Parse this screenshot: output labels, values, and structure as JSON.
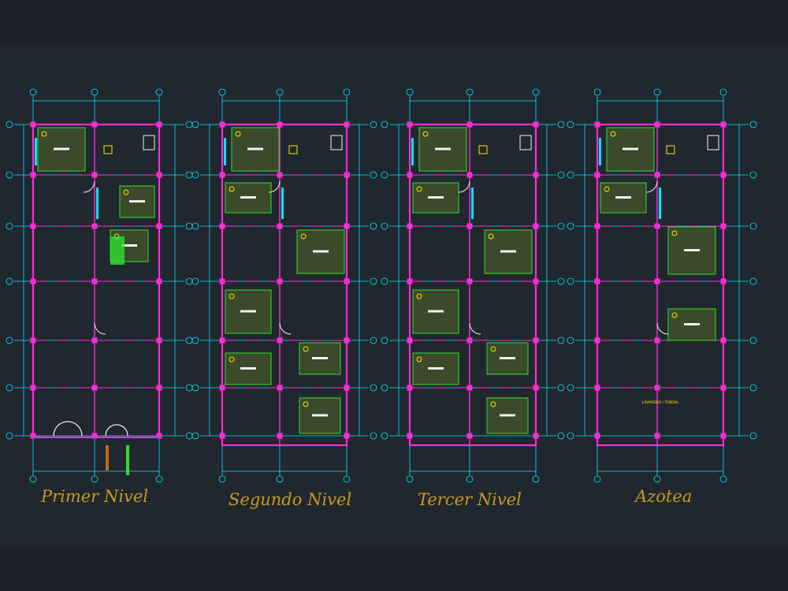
{
  "plans": [
    {
      "title": "Primer Nivel"
    },
    {
      "title": "Segundo  Nivel"
    },
    {
      "title": "Tercer  Nivel"
    },
    {
      "title": "Azotea"
    }
  ],
  "roof_note": "LAVADERO / TENDAL",
  "colors": {
    "background": "#21272e",
    "grid": "#00e5ff",
    "walls": "#ff2bd6",
    "title": "#c89a1e",
    "furniture": "#ffe600",
    "green": "#2fe02f",
    "white": "#f2f2f2"
  }
}
